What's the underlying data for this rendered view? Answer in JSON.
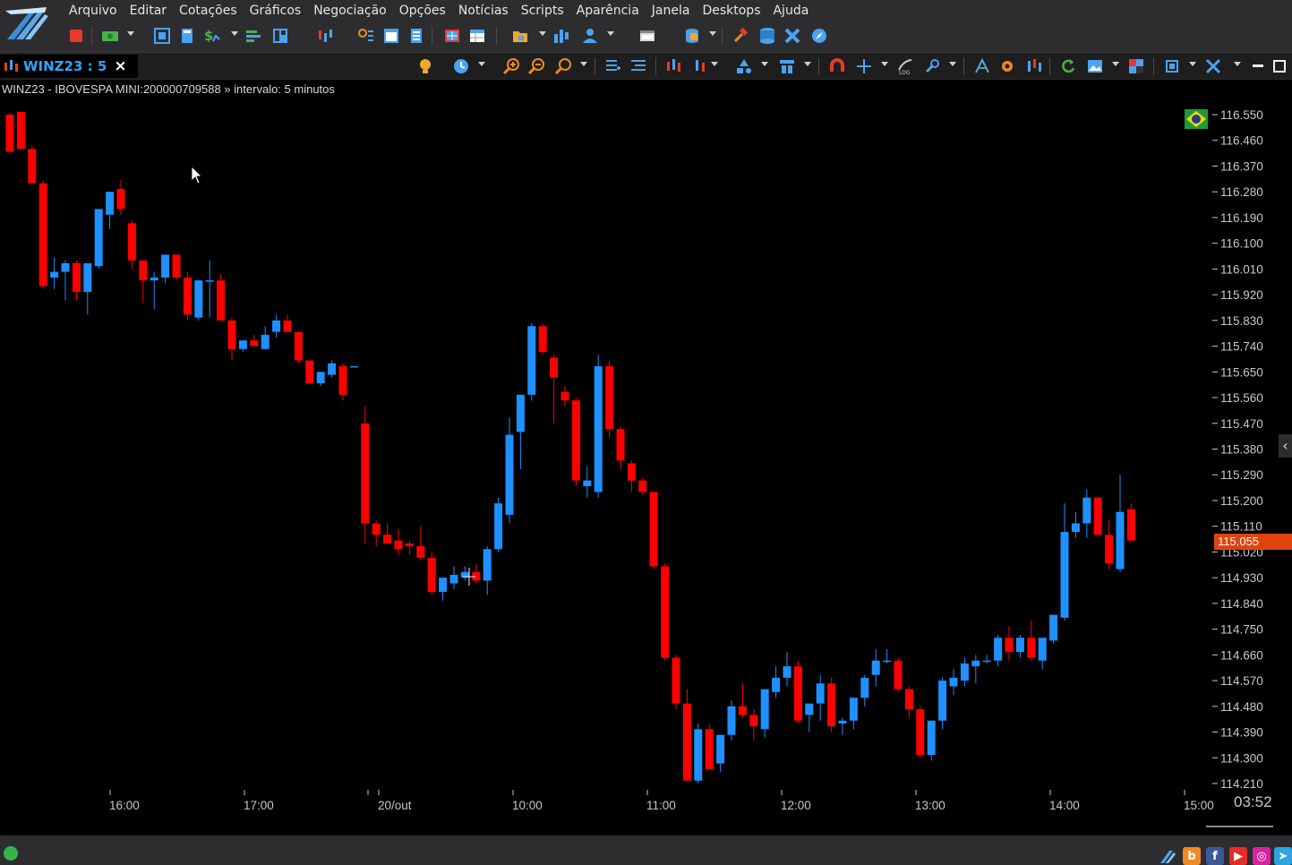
{
  "menu": [
    "Arquivo",
    "Editar",
    "Cotações",
    "Gráficos",
    "Negociação",
    "Opções",
    "Notícias",
    "Scripts",
    "Aparência",
    "Janela",
    "Desktops",
    "Ajuda"
  ],
  "tab": {
    "label": "WINZ23 : 5",
    "close": "×"
  },
  "chart_info": "WINZ23 - IBOVESPA MINI:200000709588 » intervalo: 5 minutos",
  "last_price": "115.055",
  "corner_time": "03:52",
  "colors": {
    "up": "#1e90ff",
    "down": "#ff0000",
    "background": "#000000",
    "price_tag": "#e0440e",
    "axis_text": "#c8c8c8"
  },
  "chart_data": {
    "type": "candlestick",
    "y_ticks": [
      "116.550",
      "116.460",
      "116.370",
      "116.280",
      "116.190",
      "116.100",
      "116.010",
      "115.920",
      "115.830",
      "115.740",
      "115.650",
      "115.560",
      "115.470",
      "115.380",
      "115.290",
      "115.200",
      "115.110",
      "115.020",
      "114.930",
      "114.840",
      "114.750",
      "114.660",
      "114.570",
      "114.480",
      "114.390",
      "114.300",
      "114.210"
    ],
    "ylim": [
      114.21,
      116.55
    ],
    "x_ticks": [
      "16:00",
      "17:00",
      "20/out",
      "10:00",
      "11:00",
      "12:00",
      "13:00",
      "14:00",
      "15:00"
    ],
    "candles": [
      [
        116.55,
        116.555,
        116.42,
        116.42
      ],
      [
        116.56,
        116.56,
        116.43,
        116.43
      ],
      [
        116.43,
        116.44,
        116.31,
        116.31
      ],
      [
        116.31,
        116.32,
        115.94,
        115.95
      ],
      [
        115.98,
        116.05,
        115.94,
        116.0
      ],
      [
        116.0,
        116.04,
        115.9,
        116.03
      ],
      [
        116.03,
        116.04,
        115.9,
        115.93
      ],
      [
        115.93,
        116.03,
        115.85,
        116.03
      ],
      [
        116.02,
        116.22,
        116.01,
        116.22
      ],
      [
        116.2,
        116.28,
        116.15,
        116.28
      ],
      [
        116.29,
        116.32,
        116.2,
        116.22
      ],
      [
        116.17,
        116.18,
        116.01,
        116.04
      ],
      [
        116.04,
        116.04,
        115.89,
        115.97
      ],
      [
        115.97,
        116.0,
        115.87,
        115.98
      ],
      [
        115.98,
        116.06,
        115.96,
        116.06
      ],
      [
        116.06,
        116.06,
        115.97,
        115.98
      ],
      [
        115.98,
        116.0,
        115.83,
        115.85
      ],
      [
        115.84,
        115.97,
        115.83,
        115.97
      ],
      [
        115.97,
        116.04,
        115.84,
        115.97
      ],
      [
        115.97,
        115.99,
        115.83,
        115.83
      ],
      [
        115.83,
        115.84,
        115.69,
        115.73
      ],
      [
        115.73,
        115.76,
        115.72,
        115.76
      ],
      [
        115.76,
        115.78,
        115.74,
        115.74
      ],
      [
        115.73,
        115.81,
        115.73,
        115.78
      ],
      [
        115.79,
        115.85,
        115.77,
        115.83
      ],
      [
        115.83,
        115.85,
        115.79,
        115.79
      ],
      [
        115.79,
        115.79,
        115.68,
        115.69
      ],
      [
        115.69,
        115.69,
        115.61,
        115.61
      ],
      [
        115.61,
        115.65,
        115.6,
        115.65
      ],
      [
        115.64,
        115.69,
        115.63,
        115.68
      ],
      [
        115.67,
        115.68,
        115.55,
        115.57
      ],
      [
        115.67,
        115.67,
        115.67,
        115.67
      ],
      [
        115.47,
        115.53,
        115.05,
        115.12
      ],
      [
        115.12,
        115.13,
        115.04,
        115.08
      ],
      [
        115.08,
        115.12,
        115.05,
        115.05
      ],
      [
        115.06,
        115.1,
        115.01,
        115.03
      ],
      [
        115.05,
        115.06,
        115.01,
        115.04
      ],
      [
        115.04,
        115.11,
        114.99,
        115.0
      ],
      [
        115.0,
        115.02,
        114.87,
        114.88
      ],
      [
        114.88,
        114.92,
        114.85,
        114.93
      ],
      [
        114.91,
        114.97,
        114.89,
        114.94
      ],
      [
        114.93,
        114.97,
        114.92,
        114.95
      ],
      [
        114.95,
        114.98,
        114.91,
        114.92
      ],
      [
        114.92,
        115.04,
        114.87,
        115.03
      ],
      [
        115.03,
        115.21,
        115.02,
        115.19
      ],
      [
        115.15,
        115.49,
        115.12,
        115.43
      ],
      [
        115.44,
        115.55,
        115.31,
        115.57
      ],
      [
        115.57,
        115.82,
        115.55,
        115.81
      ],
      [
        115.81,
        115.82,
        115.71,
        115.72
      ],
      [
        115.7,
        115.71,
        115.47,
        115.63
      ],
      [
        115.58,
        115.6,
        115.53,
        115.55
      ],
      [
        115.55,
        115.56,
        115.25,
        115.27
      ],
      [
        115.25,
        115.32,
        115.21,
        115.27
      ],
      [
        115.23,
        115.71,
        115.21,
        115.67
      ],
      [
        115.67,
        115.69,
        115.42,
        115.45
      ],
      [
        115.45,
        115.46,
        115.31,
        115.34
      ],
      [
        115.33,
        115.34,
        115.23,
        115.27
      ],
      [
        115.27,
        115.28,
        115.22,
        115.23
      ],
      [
        115.23,
        115.23,
        114.96,
        114.97
      ],
      [
        114.97,
        114.98,
        114.64,
        114.65
      ],
      [
        114.65,
        114.66,
        114.47,
        114.49
      ],
      [
        114.49,
        114.54,
        114.22,
        114.22
      ],
      [
        114.22,
        114.42,
        114.21,
        114.4
      ],
      [
        114.4,
        114.42,
        114.26,
        114.26
      ],
      [
        114.28,
        114.38,
        114.25,
        114.38
      ],
      [
        114.38,
        114.5,
        114.36,
        114.48
      ],
      [
        114.48,
        114.56,
        114.44,
        114.45
      ],
      [
        114.45,
        114.47,
        114.36,
        114.41
      ],
      [
        114.4,
        114.53,
        114.37,
        114.54
      ],
      [
        114.53,
        114.62,
        114.51,
        114.58
      ],
      [
        114.58,
        114.67,
        114.55,
        114.62
      ],
      [
        114.62,
        114.64,
        114.42,
        114.43
      ],
      [
        114.45,
        114.47,
        114.39,
        114.49
      ],
      [
        114.49,
        114.59,
        114.43,
        114.56
      ],
      [
        114.56,
        114.58,
        114.39,
        114.41
      ],
      [
        114.42,
        114.44,
        114.38,
        114.43
      ],
      [
        114.43,
        114.51,
        114.4,
        114.51
      ],
      [
        114.51,
        114.59,
        114.48,
        114.58
      ],
      [
        114.59,
        114.68,
        114.55,
        114.64
      ],
      [
        114.64,
        114.68,
        114.63,
        114.64
      ],
      [
        114.64,
        114.65,
        114.53,
        114.54
      ],
      [
        114.54,
        114.55,
        114.44,
        114.47
      ],
      [
        114.47,
        114.48,
        114.3,
        114.31
      ],
      [
        114.31,
        114.43,
        114.29,
        114.43
      ],
      [
        114.43,
        114.58,
        114.4,
        114.57
      ],
      [
        114.55,
        114.61,
        114.52,
        114.58
      ],
      [
        114.57,
        114.65,
        114.55,
        114.63
      ],
      [
        114.62,
        114.66,
        114.56,
        114.64
      ],
      [
        114.64,
        114.66,
        114.63,
        114.64
      ],
      [
        114.64,
        114.73,
        114.62,
        114.72
      ],
      [
        114.72,
        114.76,
        114.64,
        114.67
      ],
      [
        114.67,
        114.73,
        114.65,
        114.72
      ],
      [
        114.72,
        114.78,
        114.64,
        114.65
      ],
      [
        114.64,
        114.72,
        114.61,
        114.72
      ],
      [
        114.71,
        114.8,
        114.7,
        114.8
      ],
      [
        114.79,
        115.19,
        114.78,
        115.09
      ],
      [
        115.09,
        115.16,
        115.07,
        115.12
      ],
      [
        115.12,
        115.24,
        115.07,
        115.21
      ],
      [
        115.21,
        115.21,
        115.08,
        115.08
      ],
      [
        115.08,
        115.13,
        114.96,
        114.98
      ],
      [
        114.96,
        115.29,
        114.95,
        115.16
      ],
      [
        115.17,
        115.19,
        115.06,
        115.06
      ]
    ]
  }
}
